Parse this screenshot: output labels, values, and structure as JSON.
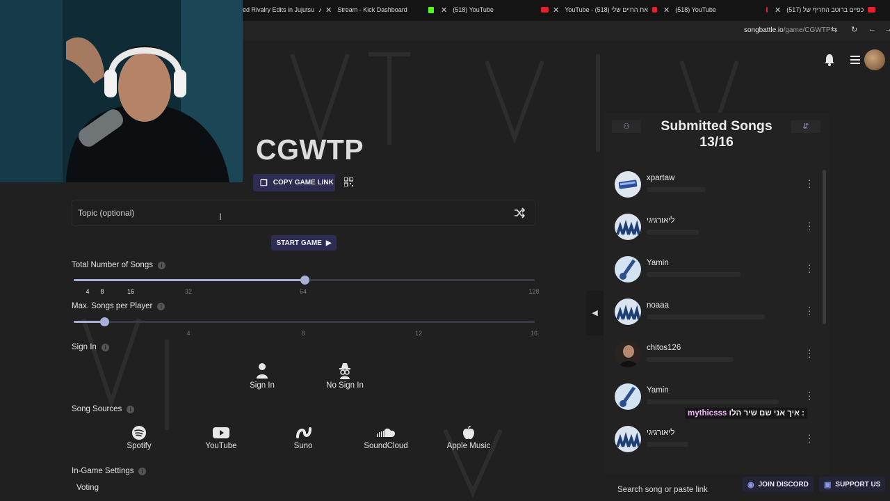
{
  "browser": {
    "tabs": [
      {
        "label": "ed Rivalry Edits in Jujutsu",
        "icon": "tiktok-icon"
      },
      {
        "label": "Stream - Kick Dashboard",
        "icon": "kick-icon"
      },
      {
        "label": "(518) YouTube",
        "icon": "youtube-icon"
      },
      {
        "label": "YouTube - (518) את החיים שלי",
        "icon": "youtube-icon"
      },
      {
        "label": "(518) YouTube",
        "icon": "youtube-icon"
      },
      {
        "label": "(517) כפיים ברוטב החריף של",
        "icon": "youtube-icon"
      }
    ],
    "url_host": "songbattle.io",
    "url_path": "/game/CGWTP"
  },
  "game": {
    "title": "CGWTP",
    "copy_link_label": "COPY GAME LINK",
    "topic_placeholder": "Topic (optional)",
    "start_label": "START GAME"
  },
  "settings": {
    "total_songs": {
      "label": "Total Number of Songs",
      "value": 16,
      "ticks": [
        "4",
        "8",
        "16",
        "32",
        "64",
        "128"
      ]
    },
    "max_per_player": {
      "label": "Max. Songs per Player",
      "value": 2,
      "ticks": [
        "4",
        "8",
        "12",
        "16"
      ]
    },
    "sign_in": {
      "label": "Sign In",
      "options": [
        {
          "label": "Sign In",
          "icon": "user-icon"
        },
        {
          "label": "No Sign In",
          "icon": "incognito-icon"
        }
      ]
    },
    "song_sources": {
      "label": "Song Sources",
      "options": [
        {
          "label": "Spotify",
          "icon": "spotify-icon"
        },
        {
          "label": "YouTube",
          "icon": "youtube-icon"
        },
        {
          "label": "Suno",
          "icon": "suno-icon"
        },
        {
          "label": "SoundCloud",
          "icon": "soundcloud-icon"
        },
        {
          "label": "Apple Music",
          "icon": "apple-icon"
        }
      ]
    },
    "in_game": {
      "label": "In-Game Settings",
      "voting_label": "Voting"
    }
  },
  "submitted": {
    "title": "Submitted Songs",
    "count": "13/16",
    "users": [
      {
        "name": "xpartaw"
      },
      {
        "name": "ליאורגיגי"
      },
      {
        "name": "Yamin"
      },
      {
        "name": "noaaa"
      },
      {
        "name": "chitos126"
      },
      {
        "name": "Yamin"
      },
      {
        "name": "ליאורגיגי"
      }
    ],
    "search_placeholder": "Search song or paste link"
  },
  "chat": {
    "user": "mythicsss",
    "message": "איך אני שם שיר הלו :"
  },
  "footer": {
    "discord_label": "JOIN DISCORD",
    "support_label": "SUPPORT US"
  },
  "colors": {
    "accent": "#2d2c52",
    "slider": "#a9b0d8",
    "background": "#202021"
  }
}
